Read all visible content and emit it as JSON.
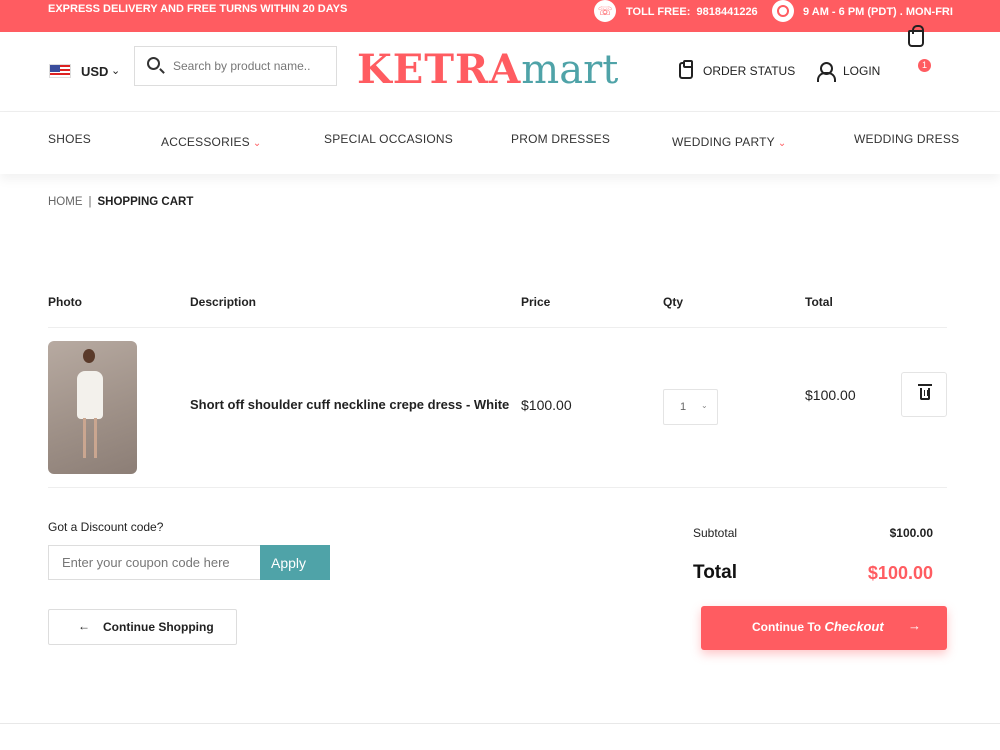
{
  "topbar": {
    "promo": "EXPRESS DELIVERY AND FREE TURNS WITHIN 20 DAYS",
    "tollfree_label": "TOLL FREE:",
    "tollfree_number": "9818441226",
    "hours": "9 AM - 6 PM (PDT) . MON-FRI"
  },
  "header": {
    "currency": "USD",
    "search_placeholder": "Search by product name..",
    "logo_part1": "KETRA",
    "logo_part2": "mart",
    "order_status": "ORDER STATUS",
    "login": "LOGIN",
    "cart_count": "1"
  },
  "nav": {
    "items": [
      {
        "label": "SHOES"
      },
      {
        "label": "ACCESSORIES"
      },
      {
        "label": "SPECIAL OCCASIONS"
      },
      {
        "label": "PROM DRESSES"
      },
      {
        "label": "WEDDING PARTY"
      },
      {
        "label": "WEDDING DRESS"
      }
    ]
  },
  "breadcrumb": {
    "home": "HOME",
    "sep": "|",
    "current": "SHOPPING CART"
  },
  "cart": {
    "columns": {
      "photo": "Photo",
      "description": "Description",
      "price": "Price",
      "qty": "Qty",
      "total": "Total"
    },
    "items": [
      {
        "description": "Short off shoulder cuff neckline crepe dress - White",
        "price": "$100.00",
        "qty": "1",
        "total": "$100.00"
      }
    ]
  },
  "discount": {
    "label": "Got a Discount code?",
    "placeholder": "Enter your coupon code here",
    "apply": "Apply"
  },
  "actions": {
    "continue_shopping": "Continue Shopping",
    "checkout_prefix": "Continue To",
    "checkout_emph": "Checkout"
  },
  "summary": {
    "subtotal_label": "Subtotal",
    "subtotal_value": "$100.00",
    "total_label": "Total",
    "total_value": "$100.00"
  },
  "colors": {
    "accent": "#ff5c61",
    "teal": "#4fa3a8"
  },
  "icons": [
    "phone-icon",
    "clock-icon",
    "flag-icon",
    "chevron-down-icon",
    "search-icon",
    "clipboard-icon",
    "user-icon",
    "cart-icon",
    "trash-icon",
    "arrow-left-icon",
    "arrow-right-icon"
  ]
}
